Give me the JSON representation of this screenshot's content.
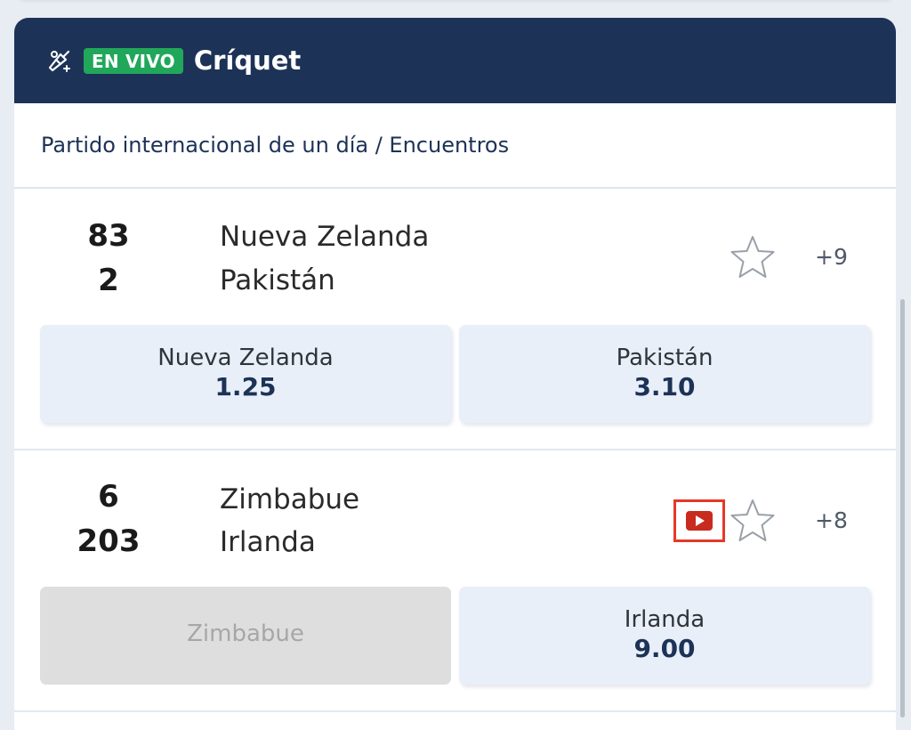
{
  "header": {
    "icon": "cricket-bat-icon",
    "live_label": "EN VIVO",
    "sport": "Críquet",
    "bg_color": "#1d3257",
    "live_color": "#21a75a"
  },
  "league": {
    "title": "Partido internacional de un día / Encuentros"
  },
  "matches": [
    {
      "home": {
        "name": "Nueva Zelanda",
        "score": "83"
      },
      "away": {
        "name": "Pakistán",
        "score": "2"
      },
      "more_markets": "+9",
      "has_video": false,
      "odds": [
        {
          "label": "Nueva Zelanda",
          "value": "1.25",
          "enabled": true
        },
        {
          "label": "Pakistán",
          "value": "3.10",
          "enabled": true
        }
      ]
    },
    {
      "home": {
        "name": "Zimbabue",
        "score": "6"
      },
      "away": {
        "name": "Irlanda",
        "score": "203"
      },
      "more_markets": "+8",
      "has_video": true,
      "video_icon": "play-video-icon",
      "odds": [
        {
          "label": "Zimbabue",
          "value": "",
          "enabled": false
        },
        {
          "label": "Irlanda",
          "value": "9.00",
          "enabled": true
        }
      ]
    }
  ]
}
